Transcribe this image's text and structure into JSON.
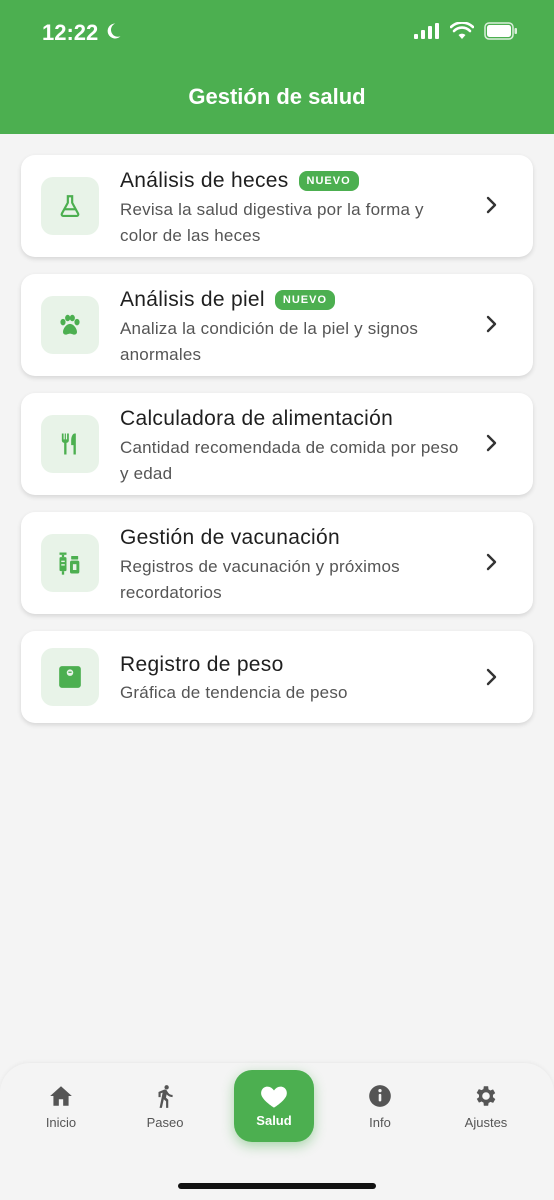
{
  "status_bar": {
    "time": "12:22"
  },
  "header": {
    "title": "Gestión de salud"
  },
  "cards": [
    {
      "title": "Análisis de heces",
      "badge": "NUEVO",
      "desc": "Revisa la salud digestiva por la forma y color de las heces",
      "icon": "flask-icon"
    },
    {
      "title": "Análisis de piel",
      "badge": "NUEVO",
      "desc": "Analiza la condición de la piel y signos anormales",
      "icon": "paw-icon"
    },
    {
      "title": "Calculadora de alimentación",
      "desc": "Cantidad recomendada de comida por peso y edad",
      "icon": "utensils-icon"
    },
    {
      "title": "Gestión de vacunación",
      "desc": "Registros de vacunación y próximos recordatorios",
      "icon": "vaccine-icon"
    },
    {
      "title": "Registro de peso",
      "desc": "Gráfica de tendencia de peso",
      "icon": "scale-icon"
    }
  ],
  "bottom_nav": {
    "items": [
      "Inicio",
      "Paseo",
      "Salud",
      "Info",
      "Ajustes"
    ],
    "active": "Salud"
  },
  "colors": {
    "accent": "#4caf50",
    "icon_bg": "#e8f3e8",
    "background": "#f4f4f4"
  }
}
